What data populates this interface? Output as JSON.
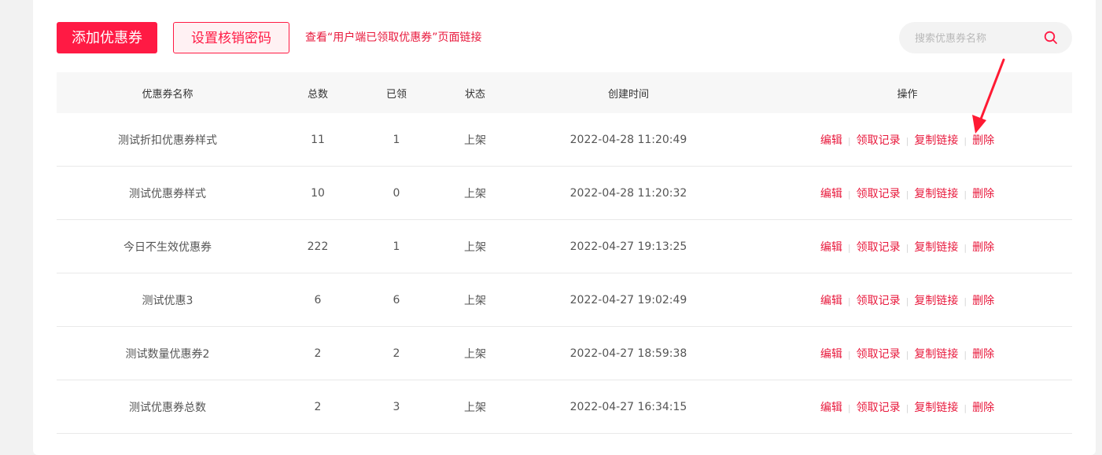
{
  "toolbar": {
    "add_label": "添加优惠券",
    "password_label": "设置核销密码",
    "view_link_label": "查看“用户端已领取优惠券”页面链接"
  },
  "search": {
    "placeholder": "搜索优惠券名称",
    "value": "",
    "icon": "search-icon"
  },
  "table": {
    "headers": [
      "优惠券名称",
      "总数",
      "已领",
      "状态",
      "创建时间",
      "操作"
    ],
    "rows": [
      {
        "name": "测试折扣优惠券样式",
        "total": "11",
        "claimed": "1",
        "status": "上架",
        "created": "2022-04-28 11:20:49"
      },
      {
        "name": "测试优惠券样式",
        "total": "10",
        "claimed": "0",
        "status": "上架",
        "created": "2022-04-28 11:20:32"
      },
      {
        "name": "今日不生效优惠券",
        "total": "222",
        "claimed": "1",
        "status": "上架",
        "created": "2022-04-27 19:13:25"
      },
      {
        "name": "测试优惠3",
        "total": "6",
        "claimed": "6",
        "status": "上架",
        "created": "2022-04-27 19:02:49"
      },
      {
        "name": "测试数量优惠券2",
        "total": "2",
        "claimed": "2",
        "status": "上架",
        "created": "2022-04-27 18:59:38"
      },
      {
        "name": "测试优惠券总数",
        "total": "2",
        "claimed": "3",
        "status": "上架",
        "created": "2022-04-27 16:34:15"
      }
    ],
    "actions": {
      "edit": "编辑",
      "records": "领取记录",
      "copy_link": "复制链接",
      "delete": "删除",
      "separator": "|"
    }
  },
  "colors": {
    "accent": "#ff1a44",
    "link": "#e8193c",
    "header_bg": "#f7f7f7",
    "page_bg": "#f2f2f2"
  }
}
